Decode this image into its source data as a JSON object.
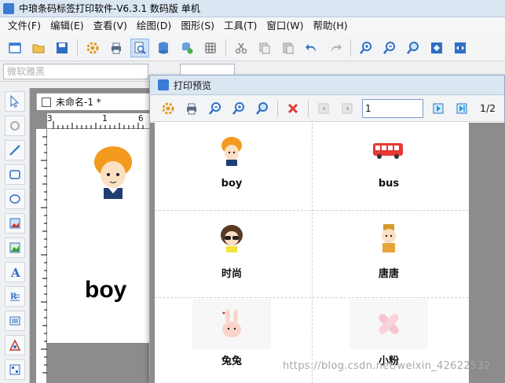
{
  "window": {
    "title": "中琅条码标签打印软件-V6.3.1 数码版 单机"
  },
  "menu": [
    "文件(F)",
    "编辑(E)",
    "查看(V)",
    "绘图(D)",
    "图形(S)",
    "工具(T)",
    "窗口(W)",
    "帮助(H)"
  ],
  "toolbar_icons": [
    "new-icon",
    "open-icon",
    "save-icon",
    "settings-icon",
    "print-icon",
    "print-preview-icon",
    "database-icon",
    "database-settings-icon",
    "grid-icon",
    "cut-icon",
    "copy-icon",
    "paste-icon",
    "undo-icon",
    "redo-icon",
    "zoom-in-icon",
    "zoom-out-icon",
    "zoom-icon",
    "fit-page-icon",
    "fit-width-icon"
  ],
  "fontbar": {
    "font": "微软雅黑",
    "size": ""
  },
  "document": {
    "tab_title": "未命名-1 *",
    "canvas_text": "boy",
    "ruler_marks": [
      "3",
      "1",
      "6"
    ]
  },
  "preview": {
    "title": "打印预览",
    "page_input": "1",
    "page_count": "1/2",
    "cells": [
      {
        "label": "boy",
        "icon": "boy-avatar-icon"
      },
      {
        "label": "bus",
        "icon": "bus-icon"
      },
      {
        "label": "时尚",
        "icon": "fashion-girl-icon"
      },
      {
        "label": "唐唐",
        "icon": "tang-character-icon"
      },
      {
        "label": "兔兔",
        "icon": "rabbit-icon"
      },
      {
        "label": "小粉",
        "icon": "pink-bandage-icon"
      }
    ]
  },
  "watermark": "https://blog.csdn.net/weixin_42622532",
  "colors": {
    "titlebar": "#dbe6f3",
    "toolbar": "#f3f4f6",
    "workspace": "#8c8c8c",
    "accent": "#3b7bd4"
  }
}
